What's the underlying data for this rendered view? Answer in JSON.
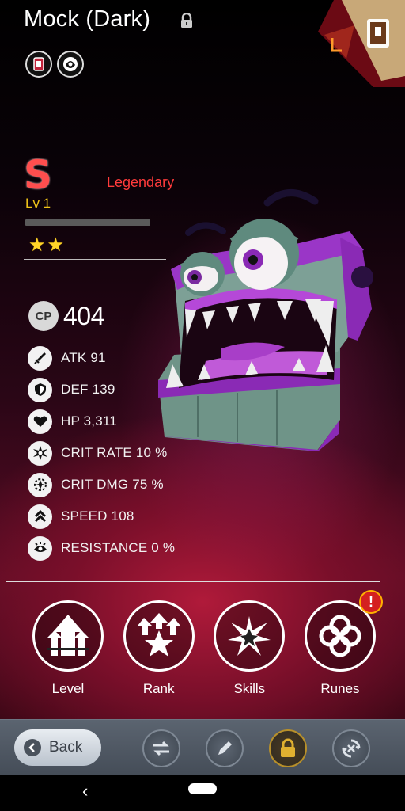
{
  "header": {
    "title": "Mock (Dark)",
    "icons": [
      "lock-icon",
      "codex-book-icon"
    ]
  },
  "type_icons": [
    "card-deck-icon",
    "dark-element-icon"
  ],
  "unit": {
    "grade": "S",
    "rarity": "Legendary",
    "level": "Lv 1",
    "xp_progress": 0,
    "stars": 2,
    "cp_badge": "CP",
    "cp_value": "404"
  },
  "stats": [
    {
      "icon": "sword-icon",
      "text": "ATK 91"
    },
    {
      "icon": "shield-icon",
      "text": "DEF 139"
    },
    {
      "icon": "heart-icon",
      "text": "HP 3,311"
    },
    {
      "icon": "crit-rate-icon",
      "text": "CRIT RATE 10 %"
    },
    {
      "icon": "crit-dmg-icon",
      "text": "CRIT DMG 75 %"
    },
    {
      "icon": "speed-icon",
      "text": "SPEED 108"
    },
    {
      "icon": "resistance-icon",
      "text": "RESISTANCE 0 %"
    }
  ],
  "actions": [
    {
      "label": "Level",
      "icon": "level-up-icon",
      "alert": false
    },
    {
      "label": "Rank",
      "icon": "rank-up-icon",
      "alert": false
    },
    {
      "label": "Skills",
      "icon": "skills-burst-icon",
      "alert": false
    },
    {
      "label": "Runes",
      "icon": "runes-knot-icon",
      "alert": true
    }
  ],
  "alert_mark": "!",
  "bottom_bar": {
    "back_label": "Back",
    "tools": [
      "swap-icon",
      "pencil-icon",
      "padlock-icon",
      "recycle-icon"
    ]
  },
  "colors": {
    "rarity": "#ff3b3b",
    "level": "#f0c419",
    "star": "#ffd428",
    "alert": "#d42020"
  }
}
